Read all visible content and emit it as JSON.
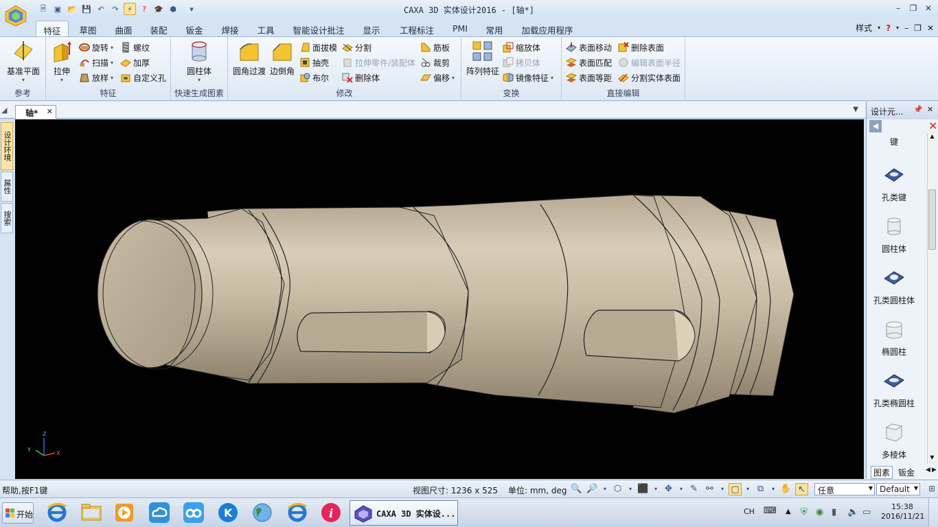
{
  "window": {
    "title": "CAXA 3D 实体设计2016 - [轴*]"
  },
  "ribbon_tabs": [
    "特征",
    "草图",
    "曲面",
    "装配",
    "钣金",
    "焊接",
    "工具",
    "智能设计批注",
    "显示",
    "工程标注",
    "PMI",
    "常用",
    "加载应用程序"
  ],
  "ribbon_right": {
    "style_label": "样式"
  },
  "groups": {
    "reference": {
      "label": "参考",
      "plane": "基准平面"
    },
    "feature": {
      "label": "特征",
      "extrude": "拉伸",
      "revolve": "旋转",
      "sweep": "扫描",
      "loft": "放样",
      "thread": "螺纹",
      "thicken": "加厚",
      "custom_hole": "自定义孔"
    },
    "quick": {
      "label": "快速生成图素",
      "cylinder": "圆柱体"
    },
    "modify": {
      "label": "修改",
      "fillet": "圆角过渡",
      "chamfer": "边倒角",
      "draft": "面拔模",
      "shell": "抽壳",
      "boolean": "布尔",
      "split": "分割",
      "extrude_part": "拉伸零件/装配体",
      "delete_body": "删除体",
      "rib": "筋板",
      "trim": "裁剪",
      "offset": "偏移"
    },
    "transform": {
      "label": "变换",
      "array": "阵列特征",
      "scale": "缩放体",
      "copy": "拷贝体",
      "mirror": "镜像特征"
    },
    "direct_edit": {
      "label": "直接编辑",
      "face_move": "表面移动",
      "face_match": "表面匹配",
      "face_equidist": "表面等距",
      "delete_face": "删除表面",
      "edit_radius": "编辑表面半径",
      "split_solid_face": "分割实体表面"
    }
  },
  "document_tab": {
    "label": "轴*"
  },
  "left_tabs": [
    "设计环境",
    "属性",
    "搜索"
  ],
  "right_panel": {
    "title": "设计元...",
    "section_label": "键",
    "items": [
      "孔类键",
      "圆柱体",
      "孔类圆柱体",
      "椭圆柱",
      "孔类椭圆柱",
      "多棱体"
    ],
    "tabs": [
      "图素",
      "钣金"
    ]
  },
  "axis_labels": {
    "x": "X",
    "y": "Y",
    "z": "Z"
  },
  "status_bar": {
    "help": "帮助,按F1键",
    "view_size": "视图尺寸: 1236 x 525",
    "units": "单位: mm, deg",
    "select_filter": "任意",
    "style_select": "Default"
  },
  "taskbar": {
    "start": "开始",
    "task_label": "CAXA 3D 实体设...",
    "language": "CH",
    "time": "15:38",
    "date": "2016/11/21"
  },
  "colors": {
    "accent": "#fbe39a",
    "ribbon_bg": "#e8f0fa",
    "viewport_bg": "#000000",
    "model_color": "#cfc3ad"
  }
}
